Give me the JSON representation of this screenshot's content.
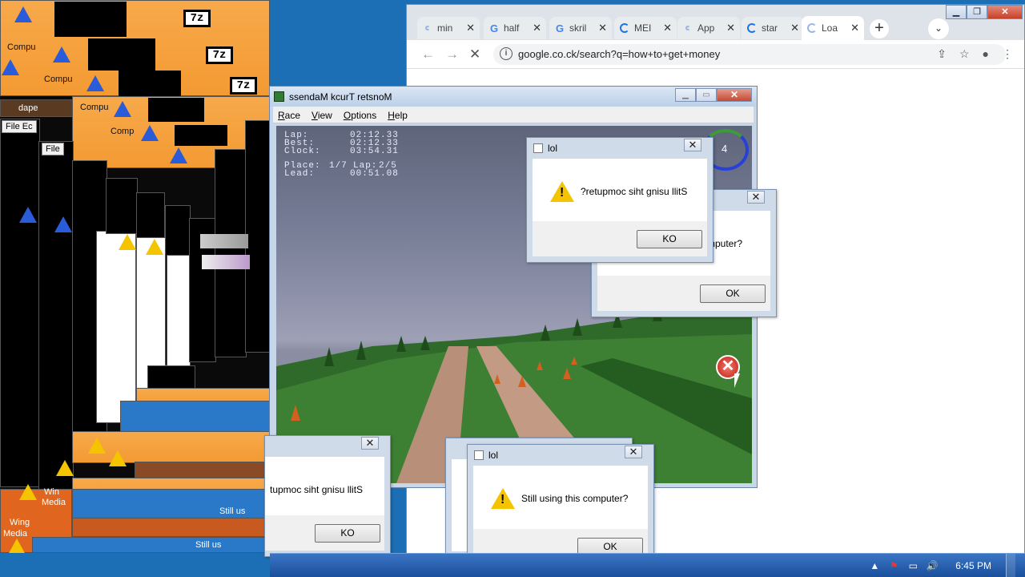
{
  "desktop": {
    "icon_label_1": "Compu",
    "icon_label_2": "Compu",
    "icon_label_3": "Compu",
    "icon_label_4": "Comp",
    "menu_file": "File",
    "menu_edit": "Ec",
    "window_title_fragment": "dape",
    "icon_label_win1": "Wing",
    "icon_label_win2": "Media",
    "icon_label_win3": "Win",
    "icon_label_win4": "Media",
    "taskbar_text_1": "Still us",
    "taskbar_text_2": "Still us",
    "zip_label": "7z"
  },
  "chrome": {
    "tabs": [
      {
        "title": "min",
        "icon": "loading-icon"
      },
      {
        "title": "half",
        "icon": "google-icon"
      },
      {
        "title": "skril",
        "icon": "google-icon"
      },
      {
        "title": "MEI",
        "icon": "loading-icon"
      },
      {
        "title": "App",
        "icon": "loading-icon"
      },
      {
        "title": "star",
        "icon": "loading-icon"
      },
      {
        "title": "Loa",
        "icon": "loading-icon"
      }
    ],
    "url": "google.co.ck/search?q=how+to+get+money",
    "google_glyph": "G",
    "close_glyph": "✕",
    "newtab_glyph": "+",
    "tabsearch_glyph": "⌄"
  },
  "game": {
    "window_title": "ssendaM kcurT retsnoM",
    "menu": [
      "Race",
      "View",
      "Options",
      "Help"
    ],
    "hud": {
      "lap_label": "Lap:",
      "lap_value": "02:12.33",
      "best_label": "Best:",
      "best_value": "02:12.33",
      "clock_label": "Clock:",
      "clock_value": "03:54.31",
      "place_label": "Place:",
      "place_value": "1/7",
      "lap_count_label": "Lap:",
      "lap_count_value": "2/5",
      "lead_label": "Lead:",
      "lead_value": "00:51.08"
    },
    "speed": "4"
  },
  "dialogs": {
    "top_reversed": {
      "title": "lol",
      "message": "?retupmoc siht gnisu llitS",
      "button": "KO"
    },
    "behind": {
      "message": "mputer?",
      "button": "OK"
    },
    "bottom_left": {
      "message": "tupmoc siht gnisu llitS",
      "button": "KO"
    },
    "bottom_front": {
      "title": "lol",
      "message": "Still using this computer?",
      "button": "OK"
    }
  },
  "taskbar": {
    "time": "6:45 PM"
  },
  "colors": {
    "warning": "#f5c400",
    "chrome_accent": "#1a73e8",
    "taskbar": "#1a4f9c"
  }
}
